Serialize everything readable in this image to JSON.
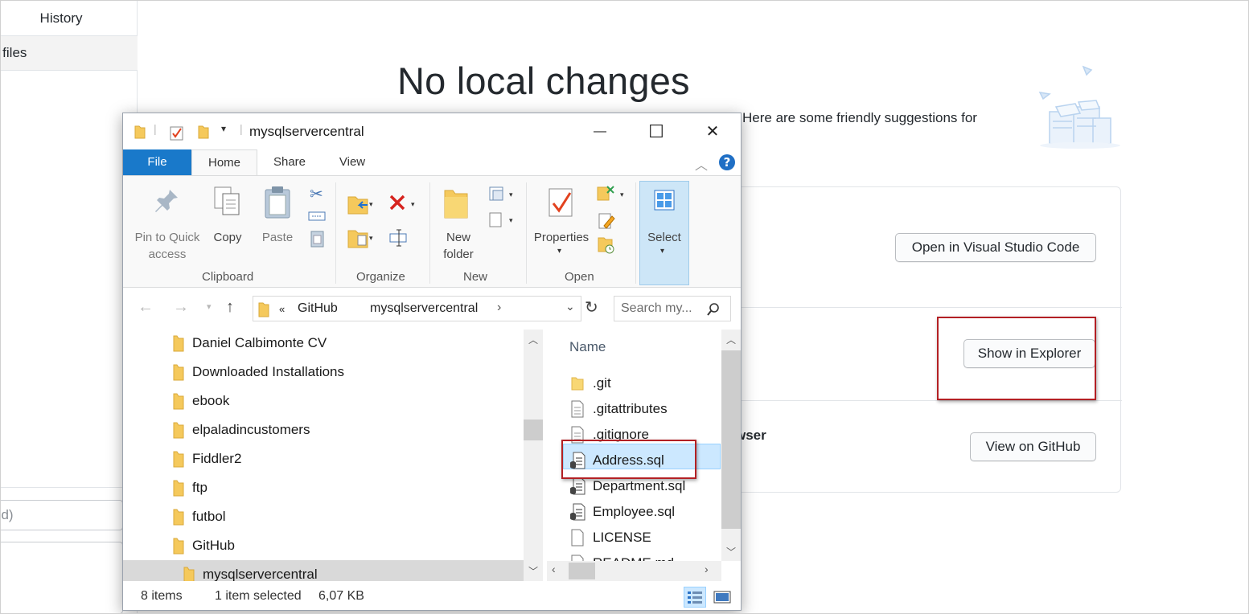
{
  "gh": {
    "tab_history": "History",
    "tab_changes_partial": "d files",
    "summary_partial": "ed)",
    "title": "No local changes",
    "subtitle_partial": "Here are some friendly suggestions for",
    "browser_partial": "wser",
    "btn_vscode": "Open in Visual Studio Code",
    "btn_explorer": "Show in Explorer",
    "btn_github": "View on GitHub"
  },
  "explorer": {
    "window_title": "mysqlservercentral",
    "controls": {
      "minimize": "—",
      "maximize": "☐",
      "close": "✕"
    },
    "tabs": {
      "file": "File",
      "home": "Home",
      "share": "Share",
      "view": "View"
    },
    "ribbon": {
      "pin_label": "Pin to Quick access",
      "copy_label": "Copy",
      "paste_label": "Paste",
      "new_folder_label": "New folder",
      "properties_label": "Properties",
      "select_label": "Select",
      "groups": {
        "clipboard": "Clipboard",
        "organize": "Organize",
        "new": "New",
        "open": "Open"
      }
    },
    "address": {
      "prefix": "«",
      "crumbs": [
        "GitHub",
        "mysqlservercentral"
      ],
      "search_placeholder": "Search my..."
    },
    "tree_items": [
      "Daniel Calbimonte CV",
      "Downloaded Installations",
      "ebook",
      "elpaladincustomers",
      "Fiddler2",
      "ftp",
      "futbol",
      "GitHub",
      "mysqlservercentral"
    ],
    "file_column_header": "Name",
    "files": [
      {
        "name": ".git",
        "icon": "folder-icon"
      },
      {
        "name": ".gitattributes",
        "icon": "text-file-icon"
      },
      {
        "name": ".gitignore",
        "icon": "text-file-icon"
      },
      {
        "name": "Address.sql",
        "icon": "sql-file-icon"
      },
      {
        "name": "Department.sql",
        "icon": "sql-file-icon"
      },
      {
        "name": "Employee.sql",
        "icon": "sql-file-icon"
      },
      {
        "name": "LICENSE",
        "icon": "blank-file-icon"
      },
      {
        "name": "README.md",
        "icon": "text-file-icon"
      }
    ],
    "status": {
      "items": "8 items",
      "selected": "1 item selected",
      "size": "6,07 KB"
    }
  },
  "colors": {
    "file_tab": "#1979ca",
    "highlight": "#b32024",
    "selection": "#cce8ff"
  }
}
